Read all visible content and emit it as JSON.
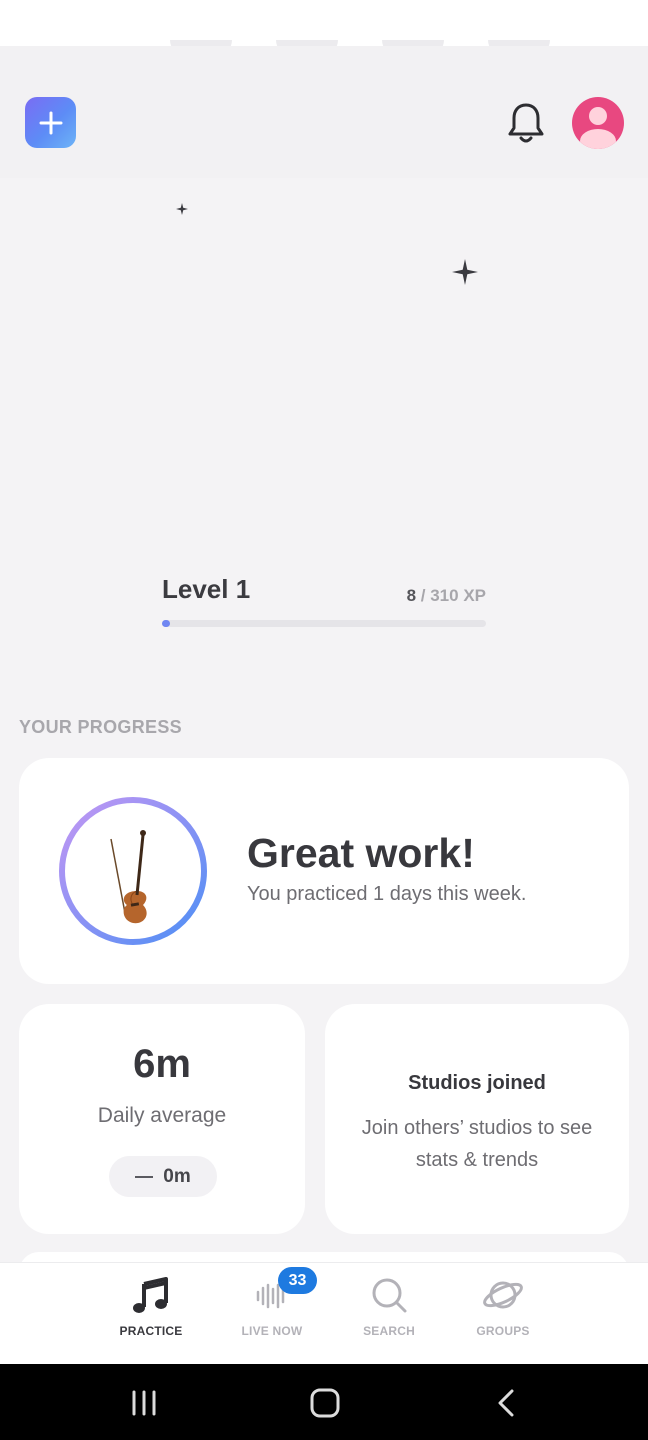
{
  "header": {
    "add_icon": "plus-icon",
    "notification_icon": "bell-icon",
    "avatar_icon": "user-avatar-icon",
    "avatar_color": "#e84880"
  },
  "level": {
    "title": "Level 1",
    "xp_current": "8",
    "xp_total": "/ 310 XP",
    "progress_fraction": 0.026
  },
  "progress": {
    "section_label": "YOUR PROGRESS",
    "main_card": {
      "headline": "Great work!",
      "subtext": "You practiced 1 days this week.",
      "instrument_icon": "violin-icon"
    },
    "daily_average": {
      "value": "6m",
      "label": "Daily average",
      "change": "0m"
    },
    "studios": {
      "title": "Studios joined",
      "description": "Join others’ studios to see stats & trends"
    }
  },
  "bottom_nav": {
    "items": [
      {
        "label": "PRACTICE",
        "icon": "music-note-icon",
        "active": true
      },
      {
        "label": "LIVE NOW",
        "icon": "sound-wave-icon",
        "active": false
      },
      {
        "label": "SEARCH",
        "icon": "search-icon",
        "active": false
      },
      {
        "label": "GROUPS",
        "icon": "planet-icon",
        "active": false
      }
    ],
    "live_badge": "33"
  },
  "colors": {
    "accent": "#6f86f2",
    "badge": "#1e7ae0",
    "background": "#f4f3f5"
  }
}
